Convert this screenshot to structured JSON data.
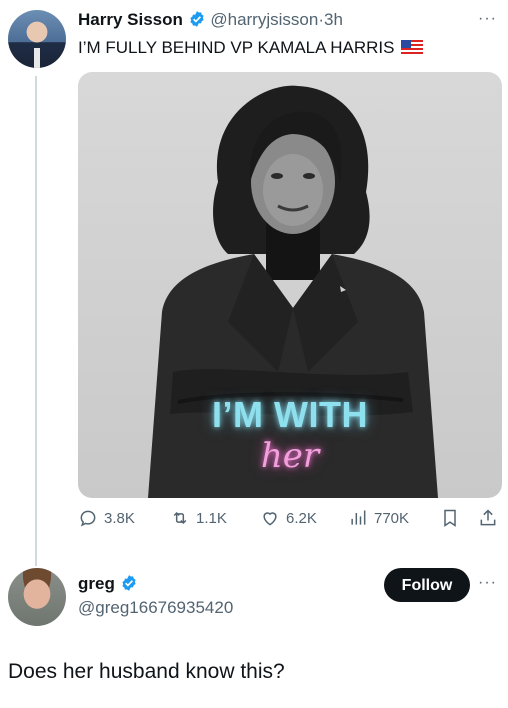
{
  "tweet": {
    "author_name": "Harry Sisson",
    "author_handle": "@harryjsisson",
    "separator": "·",
    "time": "3h",
    "text": "I’M FULLY BEHIND VP KAMALA HARRIS",
    "more_label": "···",
    "image": {
      "overlay_line1": "I’M WITH",
      "overlay_line2": "her"
    },
    "stats": {
      "replies": "3.8K",
      "reposts": "1.1K",
      "likes": "6.2K",
      "views": "770K"
    }
  },
  "reply_tweet": {
    "author_name": "greg",
    "author_handle": "@greg16676935420",
    "follow_label": "Follow",
    "more_label": "···",
    "text": "Does her husband know this?"
  },
  "colors": {
    "text_primary": "#0f1419",
    "text_secondary": "#536471",
    "verified_blue": "#1d9bf0",
    "follow_bg": "#0f1419",
    "neon_cyan": "#8fe0ef",
    "neon_pink": "#f2a0dc"
  }
}
